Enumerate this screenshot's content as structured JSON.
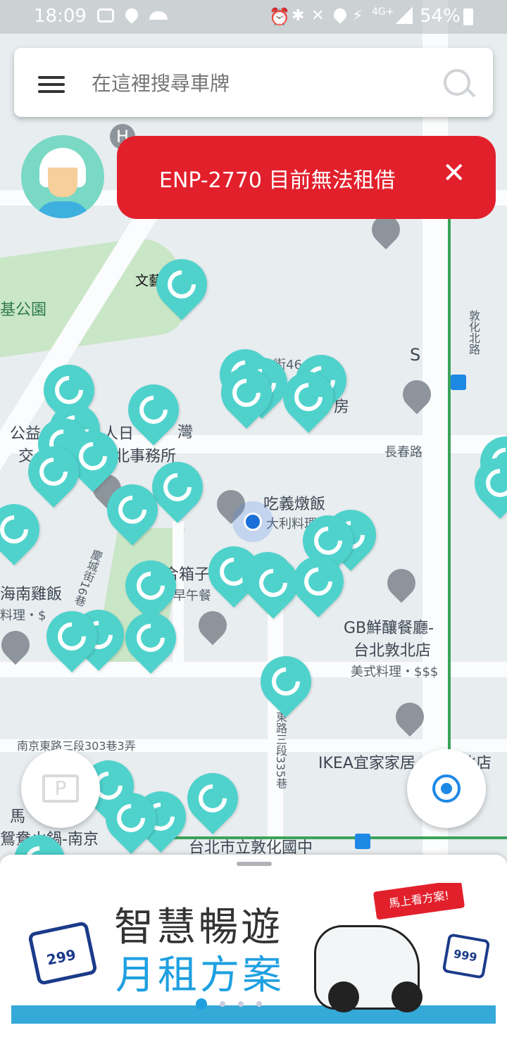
{
  "status_bar": {
    "time": "18:09",
    "battery": "54%",
    "network": "4G+"
  },
  "search": {
    "placeholder": "在這裡搜尋車牌"
  },
  "toast": {
    "message": "ENP-2770 目前無法租借"
  },
  "map": {
    "labels": {
      "park": "基公園",
      "wenyi": "文藝",
      "jie46": "街46",
      "changchun": "長春路",
      "gongyi": "公益",
      "jiao": "交",
      "renri": "人日",
      "wan": "灣",
      "beishiwusuo": "北事務所",
      "chiyi": "吃義燉飯",
      "dali": "大利料理",
      "hainan": "海南雞飯",
      "liaoli": "料理・$",
      "hexiang": "合箱子",
      "zaowu": "早午餐",
      "gb1": "GB鮮釀餐廳-",
      "gb2": "台北敦北店",
      "gb3": "美式料理・$$$",
      "ikea": "IKEA宜家家居",
      "ikea2": "北店",
      "nanjing": "南京東路三段303巷3弄",
      "ma": "馬",
      "yuanyang": "鴛鴦火鍋-南京",
      "dunhua_school": "台北市立敦化國中",
      "dunhua_north": "敦化北路",
      "lane16": "慶城街16巷",
      "lane335": "東路三段335巷",
      "fang": "房",
      "s": "S"
    }
  },
  "buttons": {
    "parking_label": "P",
    "locate_icon": "locate-icon"
  },
  "banner": {
    "line1": "智慧暢遊",
    "line2": "月租方案",
    "cta": "馬上看方案!",
    "price_left": "299",
    "price_right": "999"
  },
  "colors": {
    "accent": "#4fd2cc",
    "toast": "#e2202c"
  }
}
